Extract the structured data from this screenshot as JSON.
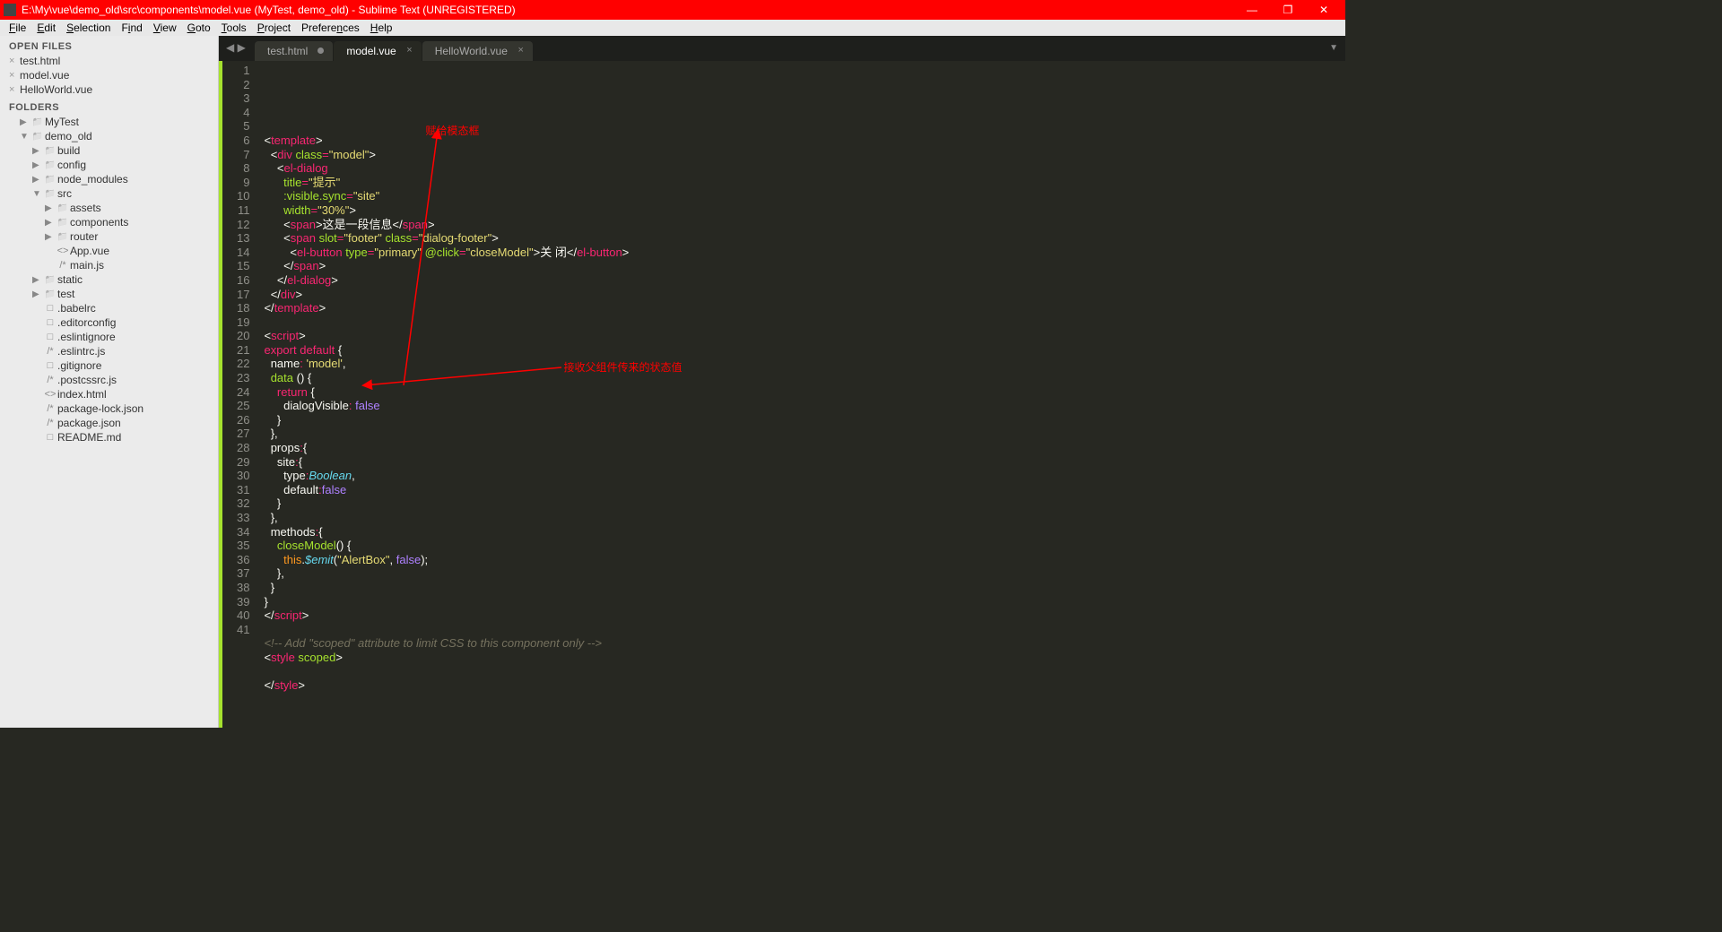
{
  "title": "E:\\My\\vue\\demo_old\\src\\components\\model.vue (MyTest, demo_old) - Sublime Text (UNREGISTERED)",
  "menu": [
    "File",
    "Edit",
    "Selection",
    "Find",
    "View",
    "Goto",
    "Tools",
    "Project",
    "Preferences",
    "Help"
  ],
  "sidebar": {
    "open_files_label": "OPEN FILES",
    "open_files": [
      "test.html",
      "model.vue",
      "HelloWorld.vue"
    ],
    "folders_label": "FOLDERS",
    "tree": [
      {
        "d": 1,
        "exp": "▶",
        "ico": "folder",
        "t": "MyTest"
      },
      {
        "d": 1,
        "exp": "▼",
        "ico": "folder-open",
        "t": "demo_old"
      },
      {
        "d": 2,
        "exp": "▶",
        "ico": "folder",
        "t": "build"
      },
      {
        "d": 2,
        "exp": "▶",
        "ico": "folder",
        "t": "config"
      },
      {
        "d": 2,
        "exp": "▶",
        "ico": "folder",
        "t": "node_modules"
      },
      {
        "d": 2,
        "exp": "▼",
        "ico": "folder-open",
        "t": "src"
      },
      {
        "d": 3,
        "exp": "▶",
        "ico": "folder",
        "t": "assets"
      },
      {
        "d": 3,
        "exp": "▶",
        "ico": "folder",
        "t": "components"
      },
      {
        "d": 3,
        "exp": "▶",
        "ico": "folder",
        "t": "router"
      },
      {
        "d": 3,
        "exp": "",
        "ico": "<>",
        "t": "App.vue"
      },
      {
        "d": 3,
        "exp": "",
        "ico": "/*",
        "t": "main.js"
      },
      {
        "d": 2,
        "exp": "▶",
        "ico": "folder",
        "t": "static"
      },
      {
        "d": 2,
        "exp": "▶",
        "ico": "folder",
        "t": "test"
      },
      {
        "d": 2,
        "exp": "",
        "ico": "□",
        "t": ".babelrc"
      },
      {
        "d": 2,
        "exp": "",
        "ico": "□",
        "t": ".editorconfig"
      },
      {
        "d": 2,
        "exp": "",
        "ico": "□",
        "t": ".eslintignore"
      },
      {
        "d": 2,
        "exp": "",
        "ico": "/*",
        "t": ".eslintrc.js"
      },
      {
        "d": 2,
        "exp": "",
        "ico": "□",
        "t": ".gitignore"
      },
      {
        "d": 2,
        "exp": "",
        "ico": "/*",
        "t": ".postcssrc.js"
      },
      {
        "d": 2,
        "exp": "",
        "ico": "<>",
        "t": "index.html"
      },
      {
        "d": 2,
        "exp": "",
        "ico": "/*",
        "t": "package-lock.json"
      },
      {
        "d": 2,
        "exp": "",
        "ico": "/*",
        "t": "package.json"
      },
      {
        "d": 2,
        "exp": "",
        "ico": "□",
        "t": "README.md"
      }
    ]
  },
  "tabs": [
    {
      "label": "test.html",
      "active": false,
      "dirty": true
    },
    {
      "label": "model.vue",
      "active": true,
      "dirty": false
    },
    {
      "label": "HelloWorld.vue",
      "active": false,
      "dirty": false
    }
  ],
  "annotations": {
    "a1": "赋给模态框",
    "a2": "接收父组件传来的状态值"
  },
  "code": {
    "source": "<template>\n  <div class=\"model\">\n    <el-dialog\n      title=\"提示\"\n      :visible.sync=\"site\"\n      width=\"30%\">\n      <span>这是一段信息</span>\n      <span slot=\"footer\" class=\"dialog-footer\">\n        <el-button type=\"primary\" @click=\"closeModel\">关 闭</el-button>\n      </span>\n    </el-dialog>\n  </div>\n</template>\n\n<script>\nexport default {\n  name: 'model',\n  data () {\n    return {\n      dialogVisible: false\n    }\n  },\n  props:{\n    site:{\n      type:Boolean,\n      default:false\n    }\n  },\n  methods:{\n    closeModel() {\n      this.$emit(\"AlertBox\", false);\n    },\n  }\n}\n</script>\n\n<!-- Add \"scoped\" attribute to limit CSS to this component only -->\n<style scoped>\n\n</style>\n"
  }
}
